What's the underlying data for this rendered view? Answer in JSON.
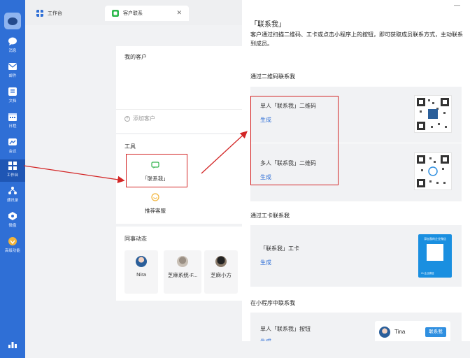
{
  "nav": {
    "items": [
      {
        "label": "消息",
        "icon": "chat-bubble-icon"
      },
      {
        "label": "邮件",
        "icon": "mail-icon"
      },
      {
        "label": "文档",
        "icon": "document-icon"
      },
      {
        "label": "日程",
        "icon": "calendar-icon"
      },
      {
        "label": "会议",
        "icon": "meeting-icon"
      },
      {
        "label": "工作台",
        "icon": "grid-icon",
        "active": true
      },
      {
        "label": "通讯录",
        "icon": "contacts-icon"
      },
      {
        "label": "微盘",
        "icon": "drive-icon"
      },
      {
        "label": "高级功能",
        "icon": "premium-icon"
      }
    ]
  },
  "tabs": [
    {
      "label": "工作台"
    },
    {
      "label": "客户联系",
      "active": true
    }
  ],
  "customers": {
    "title": "我的客户",
    "add_label": "添加客户"
  },
  "tools": {
    "title": "工具",
    "items": [
      {
        "label": "「联系我」"
      },
      {
        "label": "推荐客服"
      }
    ]
  },
  "colleagues": {
    "title": "同事动态",
    "items": [
      {
        "name": "Nira"
      },
      {
        "name": "芝麻系统-F..."
      },
      {
        "name": "芝麻小方"
      }
    ]
  },
  "panel": {
    "minimize": "—",
    "title": "「联系我」",
    "description": "客户通过扫描二维码、工卡或点击小程序上的按钮，即可获取成员联系方式，主动联系到成员。",
    "qr_section": {
      "title": "通过二维码联系我",
      "rows": [
        {
          "label": "单人「联系我」二维码",
          "link": "生成"
        },
        {
          "label": "多人「联系我」二维码",
          "link": "生成"
        }
      ]
    },
    "card_section": {
      "title": "通过工卡联系我",
      "row": {
        "label": "「联系我」工卡",
        "link": "生成"
      },
      "card_text": "添加我的企业微信",
      "card_footer": "CL企业微信"
    },
    "mini_section": {
      "title": "在小程序中联系我",
      "row": {
        "label": "单人「联系我」按钮",
        "link": "生成"
      },
      "preview_name": "Tina",
      "preview_button": "联系我"
    }
  },
  "colors": {
    "nav_bg": "#2f6fd6",
    "link": "#2f6fd6",
    "highlight": "#d32626"
  }
}
